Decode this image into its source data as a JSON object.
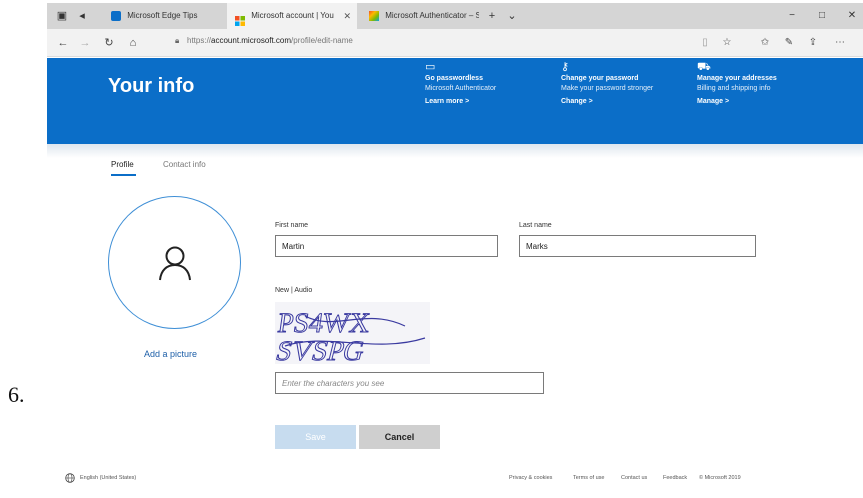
{
  "step_number": "6.",
  "browser": {
    "tabs": [
      {
        "label": "Microsoft Edge Tips",
        "active": false
      },
      {
        "label": "Microsoft account | You",
        "active": true
      },
      {
        "label": "Microsoft Authenticator – S",
        "active": false
      }
    ],
    "url_prefix": "https://",
    "url_domain": "account.microsoft.com",
    "url_path": "/profile/edit-name"
  },
  "header": {
    "title": "Your info",
    "promos": [
      {
        "title": "Go passwordless",
        "desc": "Microsoft Authenticator",
        "link": "Learn more >"
      },
      {
        "title": "Change your password",
        "desc": "Make your password stronger",
        "link": "Change >"
      },
      {
        "title": "Manage your addresses",
        "desc": "Billing and shipping info",
        "link": "Manage >"
      }
    ]
  },
  "profile_tabs": {
    "profile": "Profile",
    "contact": "Contact info"
  },
  "avatar": {
    "add_picture": "Add a picture"
  },
  "form": {
    "first_name_label": "First name",
    "first_name_value": "Martin",
    "last_name_label": "Last name",
    "last_name_value": "Marks",
    "captcha_label": "New | Audio",
    "captcha_text_line1": "PS4WX",
    "captcha_text_line2": "SVSPG",
    "captcha_placeholder": "Enter the characters you see",
    "save_label": "Save",
    "cancel_label": "Cancel"
  },
  "footer": {
    "language": "English (United States)",
    "links": [
      "Privacy & cookies",
      "Terms of use",
      "Contact us",
      "Feedback",
      "© Microsoft 2019"
    ]
  }
}
